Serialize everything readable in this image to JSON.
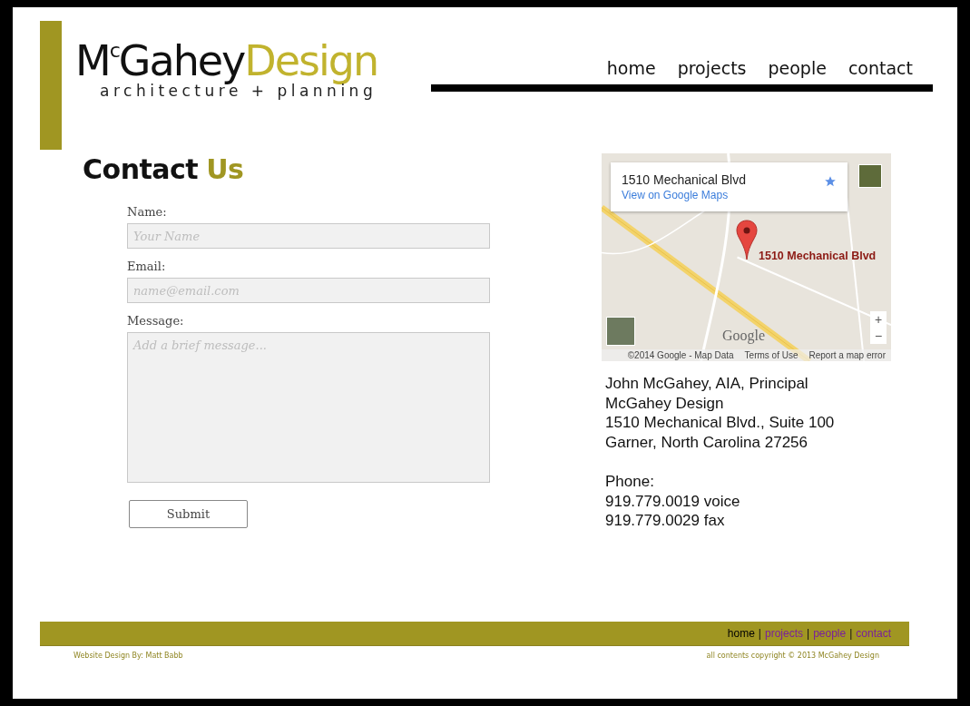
{
  "logo": {
    "name": "M$^{c}$Gahey",
    "accent": "Design",
    "tagline": "architecture + planning"
  },
  "nav": [
    {
      "label": "home"
    },
    {
      "label": "projects"
    },
    {
      "label": "people"
    },
    {
      "label": "contact"
    }
  ],
  "heading": {
    "main": "Contact",
    "accent": "Us"
  },
  "form": {
    "fields": [
      {
        "kind": "text",
        "label": "Name:",
        "placeholder": "Your Name"
      },
      {
        "kind": "text",
        "label": "Email:",
        "placeholder": "name@email.com"
      },
      {
        "kind": "textarea",
        "label": "Message:",
        "placeholder": "Add a brief message..."
      }
    ],
    "submit": "Submit"
  },
  "map": {
    "card_title": "1510 Mechanical Blvd",
    "card_link": "View on Google Maps",
    "pin_label": "1510 Mechanical Blvd",
    "zoom_in": "+",
    "zoom_out": "−",
    "brand": "Google",
    "attribution": [
      "©2014 Google - Map Data",
      "Terms of Use",
      "Report a map error"
    ]
  },
  "address": [
    "John McGahey, AIA, Principal",
    "McGahey Design",
    "1510 Mechanical Blvd., Suite 100",
    "Garner, North Carolina 27256"
  ],
  "phone": [
    "Phone:",
    "919.779.0019 voice",
    "919.779.0029 fax"
  ],
  "footer": {
    "separator": "|",
    "links": [
      {
        "label": "home",
        "selected": true
      },
      {
        "label": "projects",
        "selected": false
      },
      {
        "label": "people",
        "selected": false
      },
      {
        "label": "contact",
        "selected": false
      }
    ],
    "credit": "Website Design By: Matt Babb",
    "copyright": "all contents copyright © 2013 McGahey Design"
  }
}
